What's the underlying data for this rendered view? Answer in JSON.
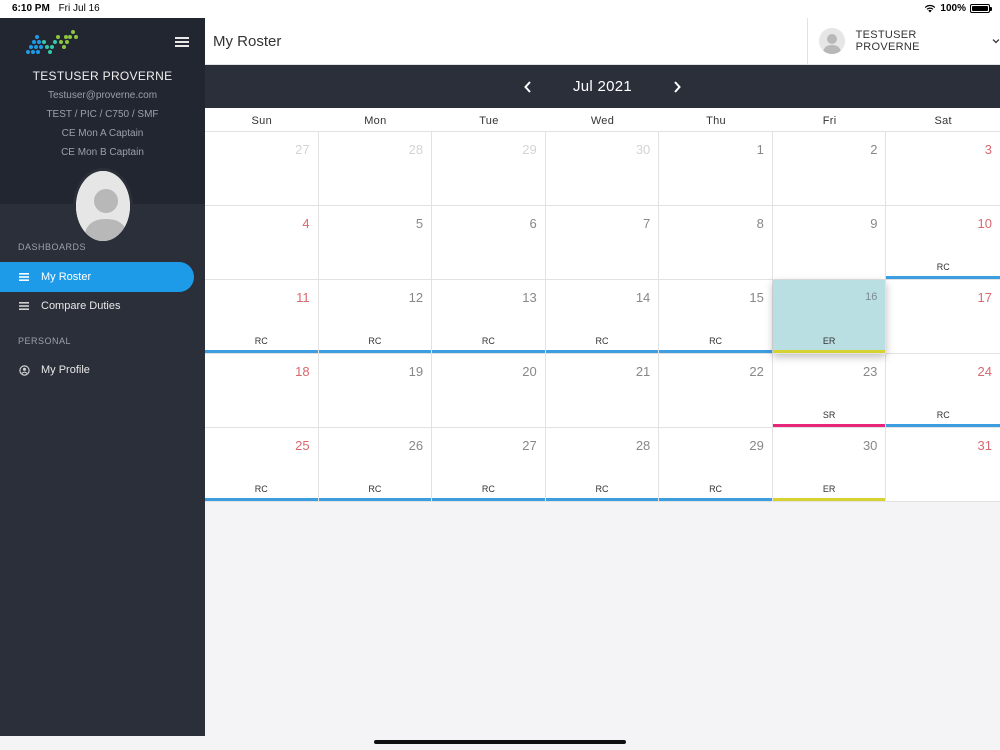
{
  "status_bar": {
    "time": "6:10 PM",
    "date": "Fri Jul 16",
    "battery": "100%"
  },
  "sidebar": {
    "user_name": "TESTUSER PROVERNE",
    "email": "Testuser@proverne.com",
    "details": [
      "TEST / PIC / C750 / SMF",
      "CE Mon A Captain",
      "CE Mon B Captain"
    ],
    "section_dashboards": "DASHBOARDS",
    "section_personal": "PERSONAL",
    "nav": [
      {
        "label": "My Roster",
        "icon": "list-icon",
        "active": true
      },
      {
        "label": "Compare Duties",
        "icon": "list-icon",
        "active": false
      },
      {
        "label": "My Profile",
        "icon": "user-circle-icon",
        "active": false
      }
    ]
  },
  "topbar": {
    "title": "My Roster",
    "user_name": "TESTUSER PROVERNE"
  },
  "calendar": {
    "month_label": "Jul 2021",
    "weekdays": [
      "Sun",
      "Mon",
      "Tue",
      "Wed",
      "Thu",
      "Fri",
      "Sat"
    ],
    "days": [
      {
        "day": "27",
        "other": true,
        "duty": "",
        "color": ""
      },
      {
        "day": "28",
        "other": true,
        "duty": "",
        "color": ""
      },
      {
        "day": "29",
        "other": true,
        "duty": "",
        "color": ""
      },
      {
        "day": "30",
        "other": true,
        "duty": "",
        "color": ""
      },
      {
        "day": "1",
        "duty": "",
        "color": ""
      },
      {
        "day": "2",
        "duty": "",
        "color": ""
      },
      {
        "day": "3",
        "duty": "",
        "color": ""
      },
      {
        "day": "4",
        "duty": "",
        "color": ""
      },
      {
        "day": "5",
        "duty": "",
        "color": ""
      },
      {
        "day": "6",
        "duty": "",
        "color": ""
      },
      {
        "day": "7",
        "duty": "",
        "color": ""
      },
      {
        "day": "8",
        "duty": "",
        "color": ""
      },
      {
        "day": "9",
        "duty": "",
        "color": ""
      },
      {
        "day": "10",
        "duty": "RC",
        "color": "#3c9ee0"
      },
      {
        "day": "11",
        "duty": "RC",
        "color": "#3c9ee0"
      },
      {
        "day": "12",
        "duty": "RC",
        "color": "#3c9ee0"
      },
      {
        "day": "13",
        "duty": "RC",
        "color": "#3c9ee0"
      },
      {
        "day": "14",
        "duty": "RC",
        "color": "#3c9ee0"
      },
      {
        "day": "15",
        "duty": "RC",
        "color": "#3c9ee0"
      },
      {
        "day": "16",
        "duty": "ER",
        "color": "#d6d232",
        "today": true
      },
      {
        "day": "17",
        "duty": "",
        "color": ""
      },
      {
        "day": "18",
        "duty": "",
        "color": ""
      },
      {
        "day": "19",
        "duty": "",
        "color": ""
      },
      {
        "day": "20",
        "duty": "",
        "color": ""
      },
      {
        "day": "21",
        "duty": "",
        "color": ""
      },
      {
        "day": "22",
        "duty": "",
        "color": ""
      },
      {
        "day": "23",
        "duty": "SR",
        "color": "#e7267a"
      },
      {
        "day": "24",
        "duty": "RC",
        "color": "#3c9ee0"
      },
      {
        "day": "25",
        "duty": "RC",
        "color": "#3c9ee0"
      },
      {
        "day": "26",
        "duty": "RC",
        "color": "#3c9ee0"
      },
      {
        "day": "27",
        "duty": "RC",
        "color": "#3c9ee0"
      },
      {
        "day": "28",
        "duty": "RC",
        "color": "#3c9ee0"
      },
      {
        "day": "29",
        "duty": "RC",
        "color": "#3c9ee0"
      },
      {
        "day": "30",
        "duty": "ER",
        "color": "#d6d232"
      },
      {
        "day": "31",
        "duty": "",
        "color": ""
      }
    ]
  },
  "colors": {
    "accent": "#1e9be8",
    "weekend": "#d9686f",
    "sidebar_bg": "#2b2f3a",
    "today_bg": "#b9dfe2"
  }
}
